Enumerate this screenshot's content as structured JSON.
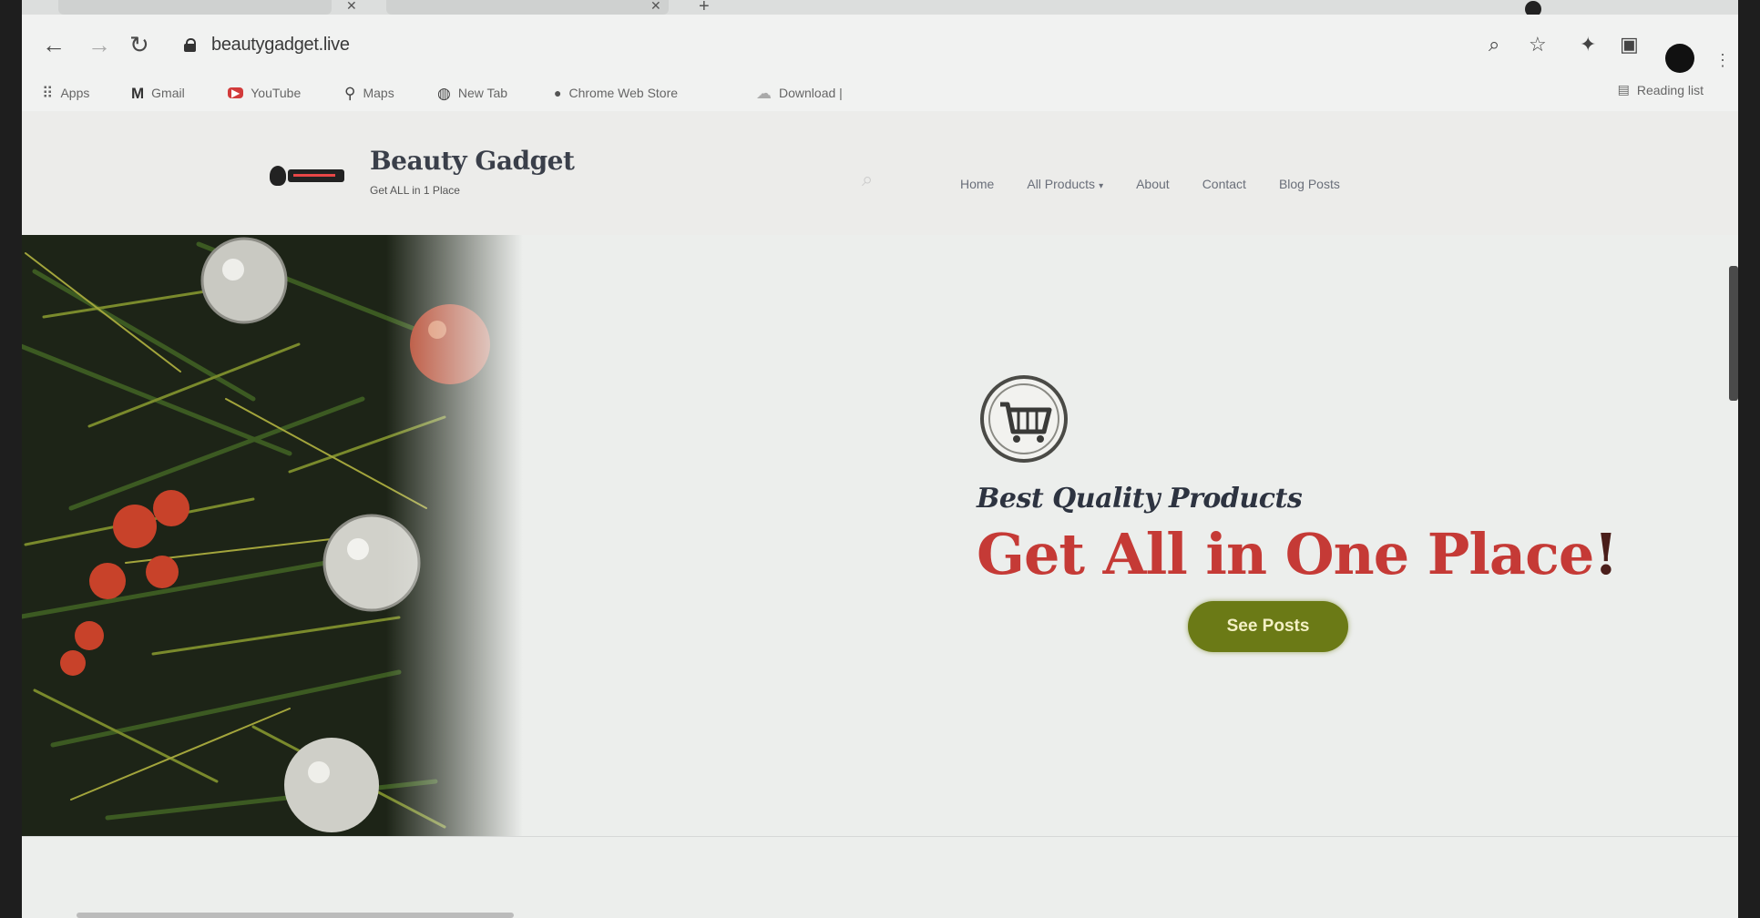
{
  "browser": {
    "tabs": [
      {
        "label": ""
      },
      {
        "label": ""
      }
    ],
    "url": "beautygadget.live",
    "bookmarks": [
      {
        "id": "apps",
        "label": "Apps",
        "icon": "apps-grid-icon"
      },
      {
        "id": "gmail",
        "label": "Gmail",
        "icon": "gmail-icon"
      },
      {
        "id": "youtube",
        "label": "YouTube",
        "icon": "youtube-icon"
      },
      {
        "id": "maps",
        "label": "Maps",
        "icon": "maps-pin-icon"
      },
      {
        "id": "newtab",
        "label": "New Tab",
        "icon": "globe-icon"
      },
      {
        "id": "chrome",
        "label": "Chrome Web Store",
        "icon": "chrome-icon"
      },
      {
        "id": "download",
        "label": "Download | ",
        "icon": "cloud-icon"
      }
    ],
    "reading_list": "Reading list"
  },
  "site": {
    "title": "Beauty Gadget",
    "tagline": "Get ALL in 1 Place",
    "nav": [
      "Home",
      "All Products",
      "About",
      "Contact",
      "Blog Posts"
    ],
    "hero": {
      "subtitle": "Best Quality Products",
      "title": "Get All in One Place",
      "title_end": "!",
      "cta": "See Posts"
    }
  },
  "colors": {
    "accent_red": "#c53a36",
    "cta_olive": "#6b7a16",
    "heading_dark": "#2d3340"
  }
}
